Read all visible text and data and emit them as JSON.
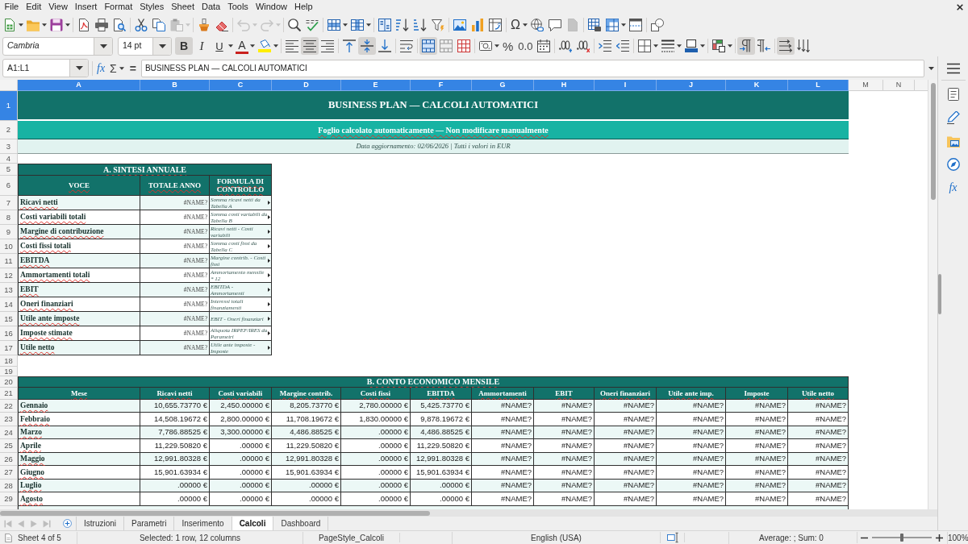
{
  "menu_bar": {
    "items": [
      "File",
      "Edit",
      "View",
      "Insert",
      "Format",
      "Styles",
      "Sheet",
      "Data",
      "Tools",
      "Window",
      "Help"
    ]
  },
  "standard_toolbar": {
    "special_character": "Ω",
    "paste_disabled": true,
    "undo_disabled": true,
    "redo_disabled": true,
    "headers_footers_disabled": true
  },
  "formatting_toolbar": {
    "font_name": "Cambria",
    "font_size": "14 pt",
    "style_buttons": [
      {
        "kind": "bold",
        "label": "B",
        "pressed": true
      },
      {
        "kind": "italic",
        "label": "I",
        "pressed": false
      },
      {
        "kind": "underline",
        "label": "U",
        "pressed": false
      }
    ],
    "font_color_label": "A",
    "horizontal_align": [
      {
        "pressed": false
      },
      {
        "pressed": true
      },
      {
        "pressed": false
      }
    ],
    "vertical_align": [
      {
        "pressed": false
      },
      {
        "pressed": true
      },
      {
        "pressed": false
      }
    ],
    "wrap_text_pressed": false,
    "merge": [
      {
        "pressed": true
      },
      {
        "pressed": false
      },
      {
        "pressed": false
      }
    ],
    "percent_label": "%",
    "decimal_label": "0.0",
    "text_direction": [
      {
        "pressed": true
      },
      {
        "pressed": false
      }
    ],
    "text_orientation": [
      {
        "pressed": true
      },
      {
        "pressed": false
      }
    ]
  },
  "formula_bar": {
    "name_box": "A1:L1",
    "function_wizard_label": "fx",
    "sum_label": "Σ",
    "equals_label": "=",
    "content": "BUSINESS PLAN — CALCOLI AUTOMATICI"
  },
  "sidebar": {
    "functions_label": "fx"
  },
  "sheet": {
    "columns": [
      {
        "label": "A",
        "selected": true
      },
      {
        "label": "B",
        "selected": true
      },
      {
        "label": "C",
        "selected": true
      },
      {
        "label": "D",
        "selected": true
      },
      {
        "label": "E",
        "selected": true
      },
      {
        "label": "F",
        "selected": true
      },
      {
        "label": "G",
        "selected": true
      },
      {
        "label": "H",
        "selected": true
      },
      {
        "label": "I",
        "selected": true
      },
      {
        "label": "J",
        "selected": true
      },
      {
        "label": "K",
        "selected": true
      },
      {
        "label": "L",
        "selected": true
      },
      {
        "label": "M",
        "selected": false
      },
      {
        "label": "N",
        "selected": false
      }
    ],
    "rows": [
      {
        "label": "1",
        "selected": true
      },
      {
        "label": "2",
        "selected": false
      },
      {
        "label": "3",
        "selected": false
      },
      {
        "label": "4",
        "selected": false
      },
      {
        "label": "5",
        "selected": false
      },
      {
        "label": "6",
        "selected": false
      },
      {
        "label": "7",
        "selected": false
      },
      {
        "label": "8",
        "selected": false
      },
      {
        "label": "9",
        "selected": false
      },
      {
        "label": "10",
        "selected": false
      },
      {
        "label": "11",
        "selected": false
      },
      {
        "label": "12",
        "selected": false
      },
      {
        "label": "13",
        "selected": false
      },
      {
        "label": "14",
        "selected": false
      },
      {
        "label": "15",
        "selected": false
      },
      {
        "label": "16",
        "selected": false
      },
      {
        "label": "17",
        "selected": false
      },
      {
        "label": "18",
        "selected": false
      },
      {
        "label": "19",
        "selected": false
      },
      {
        "label": "20",
        "selected": false
      },
      {
        "label": "21",
        "selected": false
      },
      {
        "label": "22",
        "selected": false
      },
      {
        "label": "23",
        "selected": false
      },
      {
        "label": "24",
        "selected": false
      },
      {
        "label": "25",
        "selected": false
      },
      {
        "label": "26",
        "selected": false
      },
      {
        "label": "27",
        "selected": false
      },
      {
        "label": "28",
        "selected": false
      },
      {
        "label": "29",
        "selected": false
      }
    ],
    "title": "BUSINESS PLAN — CALCOLI AUTOMATICI",
    "subtitle": "Foglio calcolato automaticamente — Non modificare manualmente",
    "info": "Data aggiornamento: 02/06/2026 | Tutti i valori in EUR",
    "summary_table": {
      "title": "A. SINTESI ANNUALE",
      "columns": [
        "VOCE",
        "TOTALE ANNO",
        "FORMULA DI CONTROLLO"
      ],
      "rows": [
        {
          "label": "Ricavi netti",
          "total": "#NAME?",
          "formula": "Somma ricavi netti da Tabella A"
        },
        {
          "label": "Costi variabili totali",
          "total": "#NAME?",
          "formula": "Somma costi variabili da Tabella B"
        },
        {
          "label": "Margine di contribuzione",
          "total": "#NAME?",
          "formula": "Ricavi netti - Costi variabili"
        },
        {
          "label": "Costi fissi totali",
          "total": "#NAME?",
          "formula": "Somma costi fissi da Tabella C"
        },
        {
          "label": "EBITDA",
          "total": "#NAME?",
          "formula": "Margine contrib. - Costi fissi"
        },
        {
          "label": "Ammortamenti totali",
          "total": "#NAME?",
          "formula": "Ammortamento mensile * 12"
        },
        {
          "label": "EBIT",
          "total": "#NAME?",
          "formula": "EBITDA - Ammortamenti"
        },
        {
          "label": "Oneri finanziari",
          "total": "#NAME?",
          "formula": "Interessi totali finanziamenti"
        },
        {
          "label": "Utile ante imposte",
          "total": "#NAME?",
          "formula": "EBIT - Oneri finanziari"
        },
        {
          "label": "Imposte stimate",
          "total": "#NAME?",
          "formula": "Aliquota IRPEF/IRES da Parametri"
        },
        {
          "label": "Utile netto",
          "total": "#NAME?",
          "formula": "Utile ante imposte - Imposte"
        }
      ]
    },
    "monthly_table": {
      "title": "B. CONTO ECONOMICO MENSILE",
      "columns": [
        "Mese",
        "Ricavi netti",
        "Costi variabili",
        "Margine contrib.",
        "Costi fissi",
        "EBITDA",
        "Ammortamenti",
        "EBIT",
        "Oneri finanziari",
        "Utile ante imp.",
        "Imposte",
        "Utile netto"
      ],
      "rows": [
        {
          "month": "Gennaio",
          "values": [
            "10,655.73770 €",
            "2,450.00000 €",
            "8,205.73770 €",
            "2,780.00000 €",
            "5,425.73770 €",
            "#NAME?",
            "#NAME?",
            "#NAME?",
            "#NAME?",
            "#NAME?",
            "#NAME?"
          ]
        },
        {
          "month": "Febbraio",
          "values": [
            "14,508.19672 €",
            "2,800.00000 €",
            "11,708.19672 €",
            "1,830.00000 €",
            "9,878.19672 €",
            "#NAME?",
            "#NAME?",
            "#NAME?",
            "#NAME?",
            "#NAME?",
            "#NAME?"
          ]
        },
        {
          "month": "Marzo",
          "values": [
            "7,786.88525 €",
            "3,300.00000 €",
            "4,486.88525 €",
            ".00000 €",
            "4,486.88525 €",
            "#NAME?",
            "#NAME?",
            "#NAME?",
            "#NAME?",
            "#NAME?",
            "#NAME?"
          ]
        },
        {
          "month": "Aprile",
          "values": [
            "11,229.50820 €",
            ".00000 €",
            "11,229.50820 €",
            ".00000 €",
            "11,229.50820 €",
            "#NAME?",
            "#NAME?",
            "#NAME?",
            "#NAME?",
            "#NAME?",
            "#NAME?"
          ]
        },
        {
          "month": "Maggio",
          "values": [
            "12,991.80328 €",
            ".00000 €",
            "12,991.80328 €",
            ".00000 €",
            "12,991.80328 €",
            "#NAME?",
            "#NAME?",
            "#NAME?",
            "#NAME?",
            "#NAME?",
            "#NAME?"
          ]
        },
        {
          "month": "Giugno",
          "values": [
            "15,901.63934 €",
            ".00000 €",
            "15,901.63934 €",
            ".00000 €",
            "15,901.63934 €",
            "#NAME?",
            "#NAME?",
            "#NAME?",
            "#NAME?",
            "#NAME?",
            "#NAME?"
          ]
        },
        {
          "month": "Luglio",
          "values": [
            ".00000 €",
            ".00000 €",
            ".00000 €",
            ".00000 €",
            ".00000 €",
            "#NAME?",
            "#NAME?",
            "#NAME?",
            "#NAME?",
            "#NAME?",
            "#NAME?"
          ]
        },
        {
          "month": "Agosto",
          "values": [
            ".00000 €",
            ".00000 €",
            ".00000 €",
            ".00000 €",
            ".00000 €",
            "#NAME?",
            "#NAME?",
            "#NAME?",
            "#NAME?",
            "#NAME?",
            "#NAME?"
          ]
        }
      ]
    }
  },
  "sheet_tabs": {
    "navigation_disabled": true,
    "tabs": [
      {
        "label": "Istruzioni",
        "selected": false
      },
      {
        "label": "Parametri",
        "selected": false
      },
      {
        "label": "Inserimento",
        "selected": false
      },
      {
        "label": "Calcoli",
        "selected": true
      },
      {
        "label": "Dashboard",
        "selected": false
      }
    ]
  },
  "status_bar": {
    "sheet_position": "Sheet 4 of 5",
    "selection": "Selected: 1 row, 12 columns",
    "page_style": "PageStyle_Calcoli",
    "language": "English (USA)",
    "aggregate": "Average: ; Sum: 0",
    "zoom_slider": {
      "level": 0.5
    },
    "zoom": "100%"
  }
}
